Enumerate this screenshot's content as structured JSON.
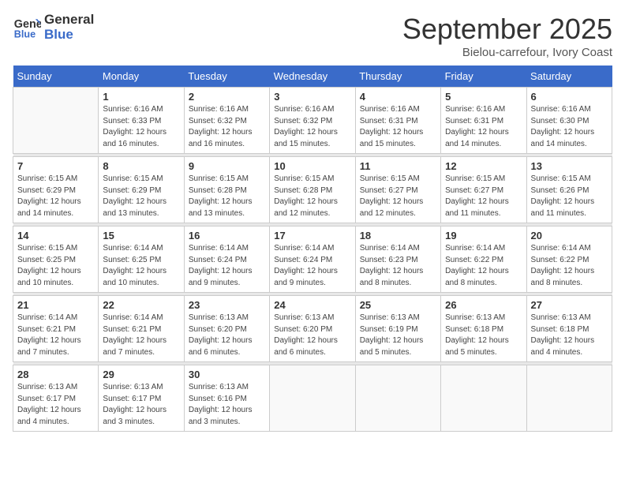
{
  "header": {
    "logo_line1": "General",
    "logo_line2": "Blue",
    "month": "September 2025",
    "location": "Bielou-carrefour, Ivory Coast"
  },
  "weekdays": [
    "Sunday",
    "Monday",
    "Tuesday",
    "Wednesday",
    "Thursday",
    "Friday",
    "Saturday"
  ],
  "weeks": [
    [
      {
        "day": "",
        "info": ""
      },
      {
        "day": "1",
        "info": "Sunrise: 6:16 AM\nSunset: 6:33 PM\nDaylight: 12 hours\nand 16 minutes."
      },
      {
        "day": "2",
        "info": "Sunrise: 6:16 AM\nSunset: 6:32 PM\nDaylight: 12 hours\nand 16 minutes."
      },
      {
        "day": "3",
        "info": "Sunrise: 6:16 AM\nSunset: 6:32 PM\nDaylight: 12 hours\nand 15 minutes."
      },
      {
        "day": "4",
        "info": "Sunrise: 6:16 AM\nSunset: 6:31 PM\nDaylight: 12 hours\nand 15 minutes."
      },
      {
        "day": "5",
        "info": "Sunrise: 6:16 AM\nSunset: 6:31 PM\nDaylight: 12 hours\nand 14 minutes."
      },
      {
        "day": "6",
        "info": "Sunrise: 6:16 AM\nSunset: 6:30 PM\nDaylight: 12 hours\nand 14 minutes."
      }
    ],
    [
      {
        "day": "7",
        "info": "Sunrise: 6:15 AM\nSunset: 6:29 PM\nDaylight: 12 hours\nand 14 minutes."
      },
      {
        "day": "8",
        "info": "Sunrise: 6:15 AM\nSunset: 6:29 PM\nDaylight: 12 hours\nand 13 minutes."
      },
      {
        "day": "9",
        "info": "Sunrise: 6:15 AM\nSunset: 6:28 PM\nDaylight: 12 hours\nand 13 minutes."
      },
      {
        "day": "10",
        "info": "Sunrise: 6:15 AM\nSunset: 6:28 PM\nDaylight: 12 hours\nand 12 minutes."
      },
      {
        "day": "11",
        "info": "Sunrise: 6:15 AM\nSunset: 6:27 PM\nDaylight: 12 hours\nand 12 minutes."
      },
      {
        "day": "12",
        "info": "Sunrise: 6:15 AM\nSunset: 6:27 PM\nDaylight: 12 hours\nand 11 minutes."
      },
      {
        "day": "13",
        "info": "Sunrise: 6:15 AM\nSunset: 6:26 PM\nDaylight: 12 hours\nand 11 minutes."
      }
    ],
    [
      {
        "day": "14",
        "info": "Sunrise: 6:15 AM\nSunset: 6:25 PM\nDaylight: 12 hours\nand 10 minutes."
      },
      {
        "day": "15",
        "info": "Sunrise: 6:14 AM\nSunset: 6:25 PM\nDaylight: 12 hours\nand 10 minutes."
      },
      {
        "day": "16",
        "info": "Sunrise: 6:14 AM\nSunset: 6:24 PM\nDaylight: 12 hours\nand 9 minutes."
      },
      {
        "day": "17",
        "info": "Sunrise: 6:14 AM\nSunset: 6:24 PM\nDaylight: 12 hours\nand 9 minutes."
      },
      {
        "day": "18",
        "info": "Sunrise: 6:14 AM\nSunset: 6:23 PM\nDaylight: 12 hours\nand 8 minutes."
      },
      {
        "day": "19",
        "info": "Sunrise: 6:14 AM\nSunset: 6:22 PM\nDaylight: 12 hours\nand 8 minutes."
      },
      {
        "day": "20",
        "info": "Sunrise: 6:14 AM\nSunset: 6:22 PM\nDaylight: 12 hours\nand 8 minutes."
      }
    ],
    [
      {
        "day": "21",
        "info": "Sunrise: 6:14 AM\nSunset: 6:21 PM\nDaylight: 12 hours\nand 7 minutes."
      },
      {
        "day": "22",
        "info": "Sunrise: 6:14 AM\nSunset: 6:21 PM\nDaylight: 12 hours\nand 7 minutes."
      },
      {
        "day": "23",
        "info": "Sunrise: 6:13 AM\nSunset: 6:20 PM\nDaylight: 12 hours\nand 6 minutes."
      },
      {
        "day": "24",
        "info": "Sunrise: 6:13 AM\nSunset: 6:20 PM\nDaylight: 12 hours\nand 6 minutes."
      },
      {
        "day": "25",
        "info": "Sunrise: 6:13 AM\nSunset: 6:19 PM\nDaylight: 12 hours\nand 5 minutes."
      },
      {
        "day": "26",
        "info": "Sunrise: 6:13 AM\nSunset: 6:18 PM\nDaylight: 12 hours\nand 5 minutes."
      },
      {
        "day": "27",
        "info": "Sunrise: 6:13 AM\nSunset: 6:18 PM\nDaylight: 12 hours\nand 4 minutes."
      }
    ],
    [
      {
        "day": "28",
        "info": "Sunrise: 6:13 AM\nSunset: 6:17 PM\nDaylight: 12 hours\nand 4 minutes."
      },
      {
        "day": "29",
        "info": "Sunrise: 6:13 AM\nSunset: 6:17 PM\nDaylight: 12 hours\nand 3 minutes."
      },
      {
        "day": "30",
        "info": "Sunrise: 6:13 AM\nSunset: 6:16 PM\nDaylight: 12 hours\nand 3 minutes."
      },
      {
        "day": "",
        "info": ""
      },
      {
        "day": "",
        "info": ""
      },
      {
        "day": "",
        "info": ""
      },
      {
        "day": "",
        "info": ""
      }
    ]
  ]
}
